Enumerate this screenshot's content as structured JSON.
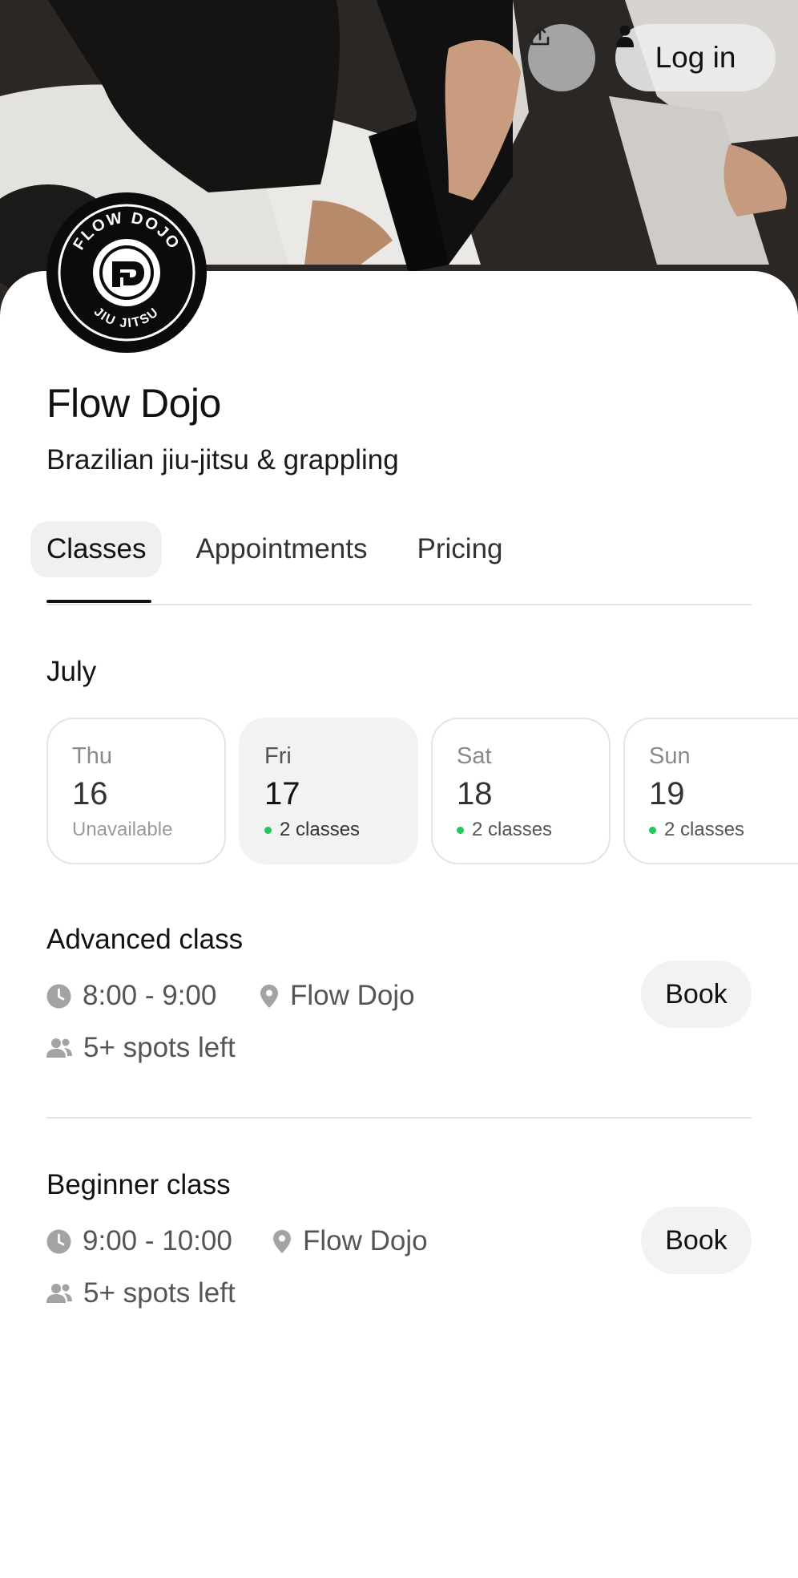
{
  "header": {
    "share_icon": "share-upload-icon",
    "login_icon": "person-icon",
    "login_label": "Log in"
  },
  "business": {
    "name": "Flow Dojo",
    "tagline": "Brazilian jiu-jitsu & grappling",
    "logo": {
      "top_text": "FLOW DOJO",
      "bottom_text": "JIU JITSU"
    }
  },
  "tabs": [
    {
      "label": "Classes",
      "active": true
    },
    {
      "label": "Appointments",
      "active": false
    },
    {
      "label": "Pricing",
      "active": false
    }
  ],
  "calendar": {
    "month": "July",
    "days": [
      {
        "weekday": "Thu",
        "date": "16",
        "status": "Unavailable",
        "available": false,
        "selected": false
      },
      {
        "weekday": "Fri",
        "date": "17",
        "status": "2 classes",
        "available": true,
        "selected": true
      },
      {
        "weekday": "Sat",
        "date": "18",
        "status": "2 classes",
        "available": true,
        "selected": false
      },
      {
        "weekday": "Sun",
        "date": "19",
        "status": "2 classes",
        "available": true,
        "selected": false
      }
    ]
  },
  "classes": [
    {
      "name": "Advanced class",
      "time": "8:00 - 9:00",
      "location": "Flow Dojo",
      "spots": "5+ spots left",
      "book_label": "Book"
    },
    {
      "name": "Beginner class",
      "time": "9:00 - 10:00",
      "location": "Flow Dojo",
      "spots": "5+ spots left",
      "book_label": "Book"
    }
  ],
  "colors": {
    "available_dot": "#22c55e",
    "chip_bg": "#f2f2f2",
    "text": "#111111"
  }
}
